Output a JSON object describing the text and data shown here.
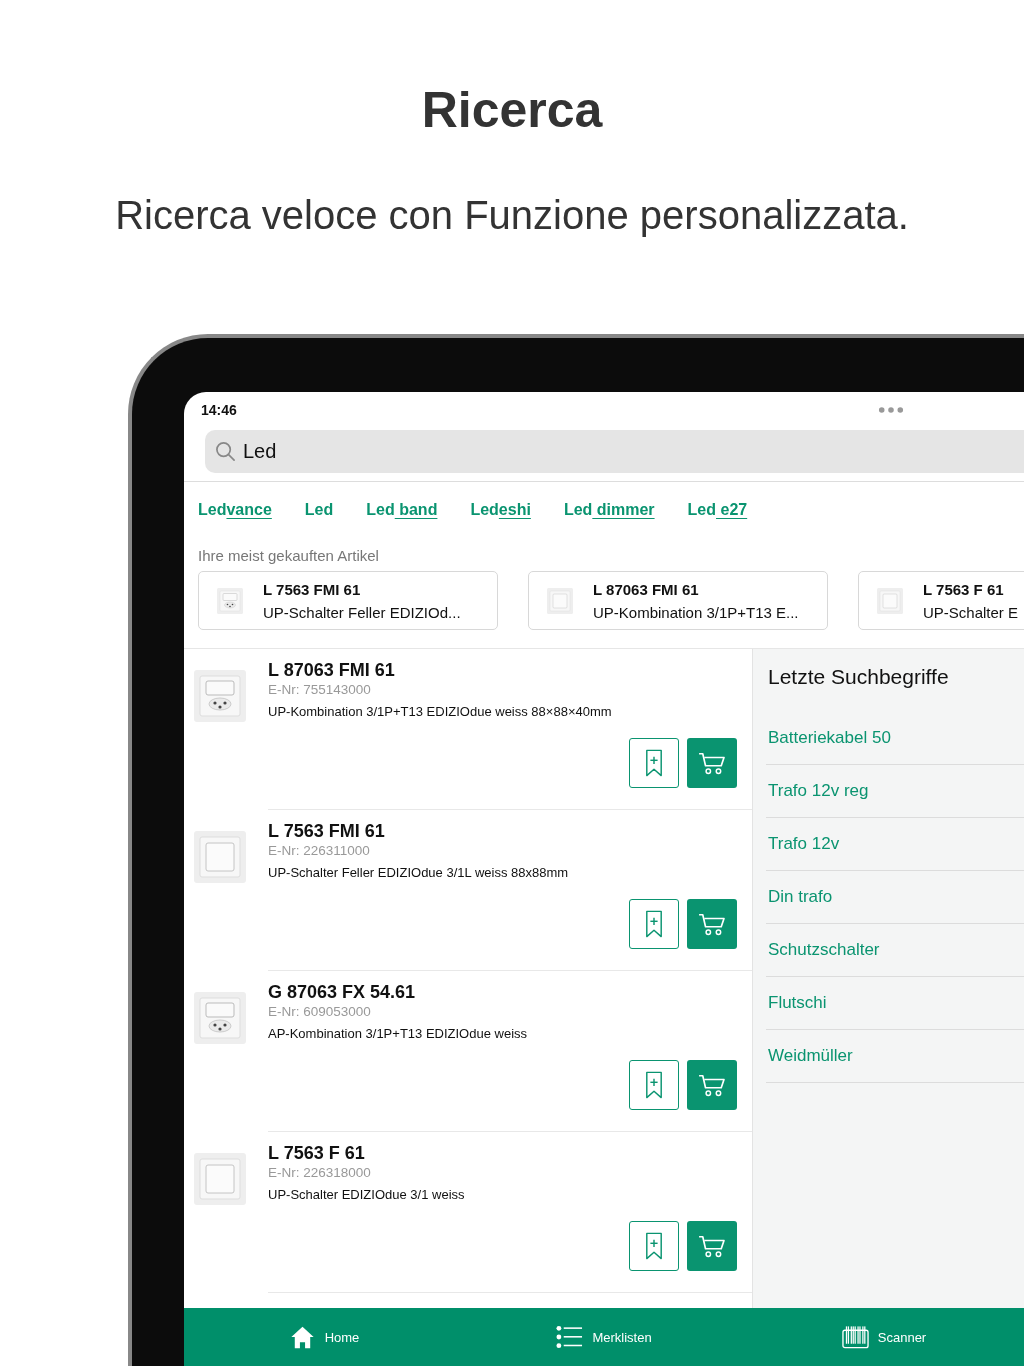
{
  "page": {
    "title": "Ricerca",
    "subtitle": "Ricerca veloce con Funzione personalizzata."
  },
  "status_bar": {
    "time": "14:46"
  },
  "search": {
    "value": "Led"
  },
  "suggestions": [
    {
      "typed": "Led",
      "completion": "vance"
    },
    {
      "typed": "Led"
    },
    {
      "typed": "Led",
      "completion": " band"
    },
    {
      "typed": "Led",
      "completion": "eshi"
    },
    {
      "typed": "Led",
      "completion": " dimmer"
    },
    {
      "typed": "Led",
      "completion": " e27"
    }
  ],
  "frequent": {
    "heading": "Ihre meist gekauften Artikel",
    "cards": [
      {
        "code": "L 7563 FMI 61",
        "description": "UP-Schalter Feller EDIZIOd..."
      },
      {
        "code": "L 87063 FMI 61",
        "description": "UP-Kombination 3/1P+T13 E..."
      },
      {
        "code": "L 7563 F 61",
        "description": "UP-Schalter E"
      }
    ]
  },
  "results": [
    {
      "code": "L 87063 FMI 61",
      "enr": "E-Nr: 755143000",
      "description": "UP-Kombination 3/1P+T13 EDIZIOdue weiss 88×88×40mm"
    },
    {
      "code": "L 7563 FMI 61",
      "enr": "E-Nr: 226311000",
      "description": "UP-Schalter Feller EDIZIOdue 3/1L weiss 88x88mm"
    },
    {
      "code": "G 87063 FX 54.61",
      "enr": "E-Nr: 609053000",
      "description": "AP-Kombination 3/1P+T13 EDIZIOdue weiss"
    },
    {
      "code": "L 7563 F 61",
      "enr": "E-Nr: 226318000",
      "description": "UP-Schalter EDIZIOdue 3/1 weiss"
    }
  ],
  "recent": {
    "heading": "Letzte Suchbegriffe",
    "items": [
      "Batteriekabel 50",
      "Trafo 12v reg",
      "Trafo 12v",
      "Din trafo",
      "Schutzschalter",
      "Flutschi",
      "Weidmüller"
    ]
  },
  "tab_bar": [
    {
      "label": "Home",
      "kind": "home"
    },
    {
      "label": "Merklisten",
      "kind": "list"
    },
    {
      "label": "Scanner",
      "kind": "scanner"
    }
  ]
}
